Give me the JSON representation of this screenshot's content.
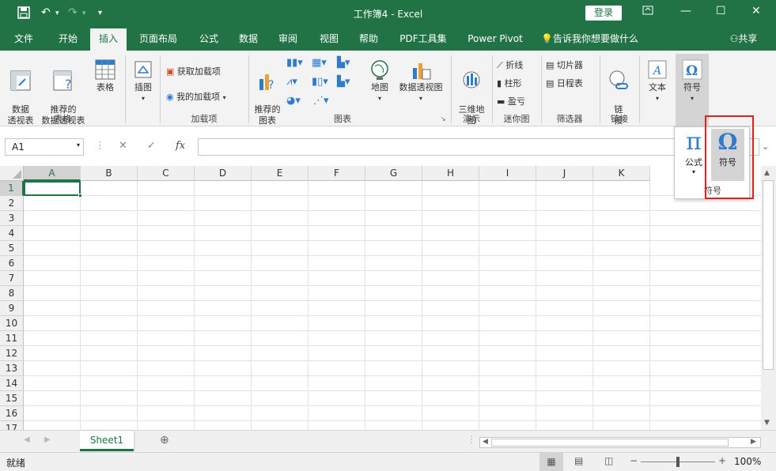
{
  "window": {
    "title": "工作簿4  -  Excel",
    "login_label": "登录",
    "accent": "#217346"
  },
  "tabs": [
    "文件",
    "开始",
    "插入",
    "页面布局",
    "公式",
    "数据",
    "审阅",
    "视图",
    "帮助",
    "PDF工具集",
    "Power Pivot"
  ],
  "active_tab": "插入",
  "tell_me": "告诉我你想要做什么",
  "share": "共享",
  "ribbon": {
    "pivot_table": "数据\n透视表",
    "recommended_pivot": "推荐的\n数据透视表",
    "table": "表格",
    "group_tables": "表格",
    "illustrations": "插图",
    "get_addins": "获取加载项",
    "my_addins": "我的加载项",
    "group_addins": "加载项",
    "recommended_charts": "推荐的\n图表",
    "maps": "地图",
    "pivot_chart": "数据透视图",
    "group_charts": "图表",
    "map3d": "三维地\n图",
    "group_tours": "演示",
    "sparkline_line": "折线",
    "sparkline_column": "柱形",
    "sparkline_winloss": "盈亏",
    "group_sparklines": "迷你图",
    "slicer": "切片器",
    "timeline": "日程表",
    "group_filters": "筛选器",
    "link": "链\n接",
    "group_links": "链接",
    "text": "文本",
    "symbols": "符号"
  },
  "popup": {
    "equation": "公式",
    "symbol": "符号",
    "group_label": "符号"
  },
  "formula_bar": {
    "name_box": "A1",
    "cancel": "✕",
    "enter": "✓",
    "fx": "fx",
    "value": ""
  },
  "columns": [
    "A",
    "B",
    "C",
    "D",
    "E",
    "F",
    "G",
    "H",
    "I",
    "J",
    "K"
  ],
  "rows": [
    "1",
    "2",
    "3",
    "4",
    "5",
    "6",
    "7",
    "8",
    "9",
    "10",
    "11",
    "12",
    "13",
    "14",
    "15",
    "16",
    "17"
  ],
  "sheets": [
    "Sheet1"
  ],
  "status": {
    "ready": "就绪",
    "zoom": "100%"
  }
}
